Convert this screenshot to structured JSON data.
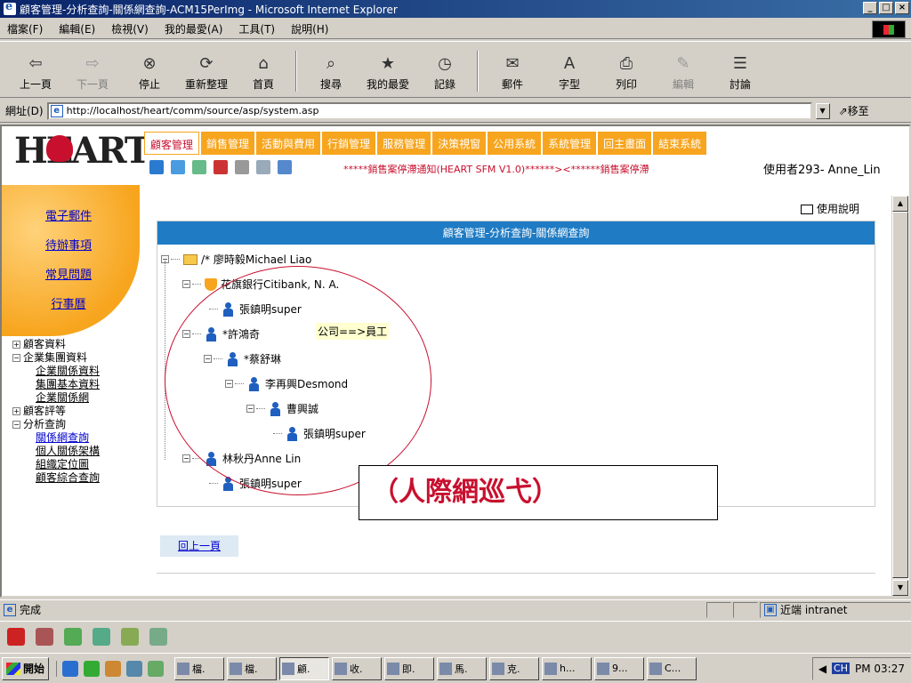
{
  "window": {
    "title": "顧客管理-分析查詢-關係網查詢-ACM15PerImg - Microsoft Internet Explorer",
    "min": "_",
    "max": "□",
    "close": "×"
  },
  "menu": [
    "檔案(F)",
    "編輯(E)",
    "檢視(V)",
    "我的最愛(A)",
    "工具(T)",
    "說明(H)"
  ],
  "toolbar": [
    {
      "label": "上一頁",
      "icon": "back-icon",
      "glyph": "⇦"
    },
    {
      "label": "下一頁",
      "icon": "forward-icon",
      "glyph": "⇨",
      "disabled": true
    },
    {
      "label": "停止",
      "icon": "stop-icon",
      "glyph": "⊗"
    },
    {
      "label": "重新整理",
      "icon": "refresh-icon",
      "glyph": "⟳"
    },
    {
      "label": "首頁",
      "icon": "home-icon",
      "glyph": "⌂"
    },
    {
      "label": "搜尋",
      "icon": "search-icon",
      "glyph": "⌕"
    },
    {
      "label": "我的最愛",
      "icon": "favorites-icon",
      "glyph": "★"
    },
    {
      "label": "記錄",
      "icon": "history-icon",
      "glyph": "◷"
    },
    {
      "label": "郵件",
      "icon": "mail-icon",
      "glyph": "✉"
    },
    {
      "label": "字型",
      "icon": "font-icon",
      "glyph": "A"
    },
    {
      "label": "列印",
      "icon": "print-icon",
      "glyph": "⎙"
    },
    {
      "label": "編輯",
      "icon": "edit-icon",
      "glyph": "✎",
      "disabled": true
    },
    {
      "label": "討論",
      "icon": "discuss-icon",
      "glyph": "☰"
    }
  ],
  "address": {
    "label": "網址(D)",
    "url": "http://localhost/heart/comm/source/asp/system.asp",
    "go": "移至"
  },
  "logo": {
    "text": "HEART"
  },
  "quick_links": [
    "電子郵件",
    "待辦事項",
    "常見問題",
    "行事曆"
  ],
  "left_tree": {
    "customer_data": "顧客資料",
    "group_data": "企業集團資料",
    "group_items": [
      "企業關係資料",
      "集團基本資料",
      "企業關係網"
    ],
    "rating": "顧客評等",
    "analysis": "分析查詢",
    "analysis_items": [
      "關係網查詢",
      "個人關係架構",
      "組織定位圖",
      "顧客綜合查詢"
    ]
  },
  "nav": [
    "顧客管理",
    "銷售管理",
    "活動與費用",
    "行銷管理",
    "服務管理",
    "決策視窗",
    "公用系統",
    "系統管理",
    "回主畫面",
    "結束系統"
  ],
  "marquee": "*****銷售案停滯通知(HEART SFM V1.0)******><******銷售案停滯",
  "user": "使用者293- Anne_Lin",
  "help": "使用說明",
  "panel_title": "顧客管理-分析查詢-關係網查詢",
  "tree": {
    "root": "/* 廖時毅Michael Liao",
    "n1": "花旗銀行Citibank, N. A.",
    "n1a": "張鎮明super",
    "n2": "*許鴻奇",
    "n2a": "*蔡舒琳",
    "n2b": "李再興Desmond",
    "n2c": "曹興誠",
    "n2d": "張鎮明super",
    "n3": "林秋丹Anne Lin",
    "n3a": "張鎮明super"
  },
  "tooltip": "公司==>員工",
  "callout": "（人際網巡弋）",
  "back": "回上一頁",
  "status": {
    "text": "完成",
    "zone": "近端 intranet"
  },
  "taskbar": {
    "start": "開始",
    "tasks": [
      "檔.",
      "檔.",
      "顧.",
      "收.",
      "即.",
      "馬.",
      "克.",
      "h...",
      "9...",
      "C..."
    ],
    "ime": "CH",
    "clock": "PM 03:27"
  }
}
